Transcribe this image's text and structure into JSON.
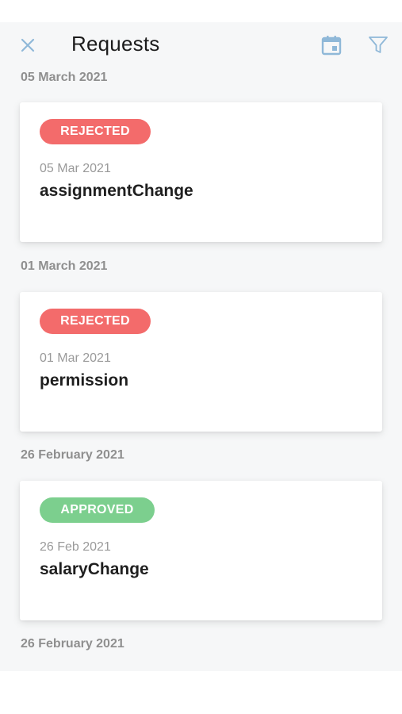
{
  "header": {
    "title": "Requests",
    "close_icon": "close-icon",
    "calendar_icon": "calendar-icon",
    "filter_icon": "filter-icon",
    "accent_color": "#8fb8d8"
  },
  "groups": [
    {
      "date": "05 March 2021",
      "card": {
        "status": "REJECTED",
        "date": "05 Mar 2021",
        "type": "assignmentChange"
      }
    },
    {
      "date": "01 March 2021",
      "card": {
        "status": "REJECTED",
        "date": "01 Mar 2021",
        "type": "permission"
      }
    },
    {
      "date": "26 February 2021",
      "card": {
        "status": "APPROVED",
        "date": "26 Feb 2021",
        "type": "salaryChange"
      }
    },
    {
      "date": "26 February 2021"
    }
  ],
  "colors": {
    "rejected": "#f36b6b",
    "approved": "#7ccf8e"
  }
}
